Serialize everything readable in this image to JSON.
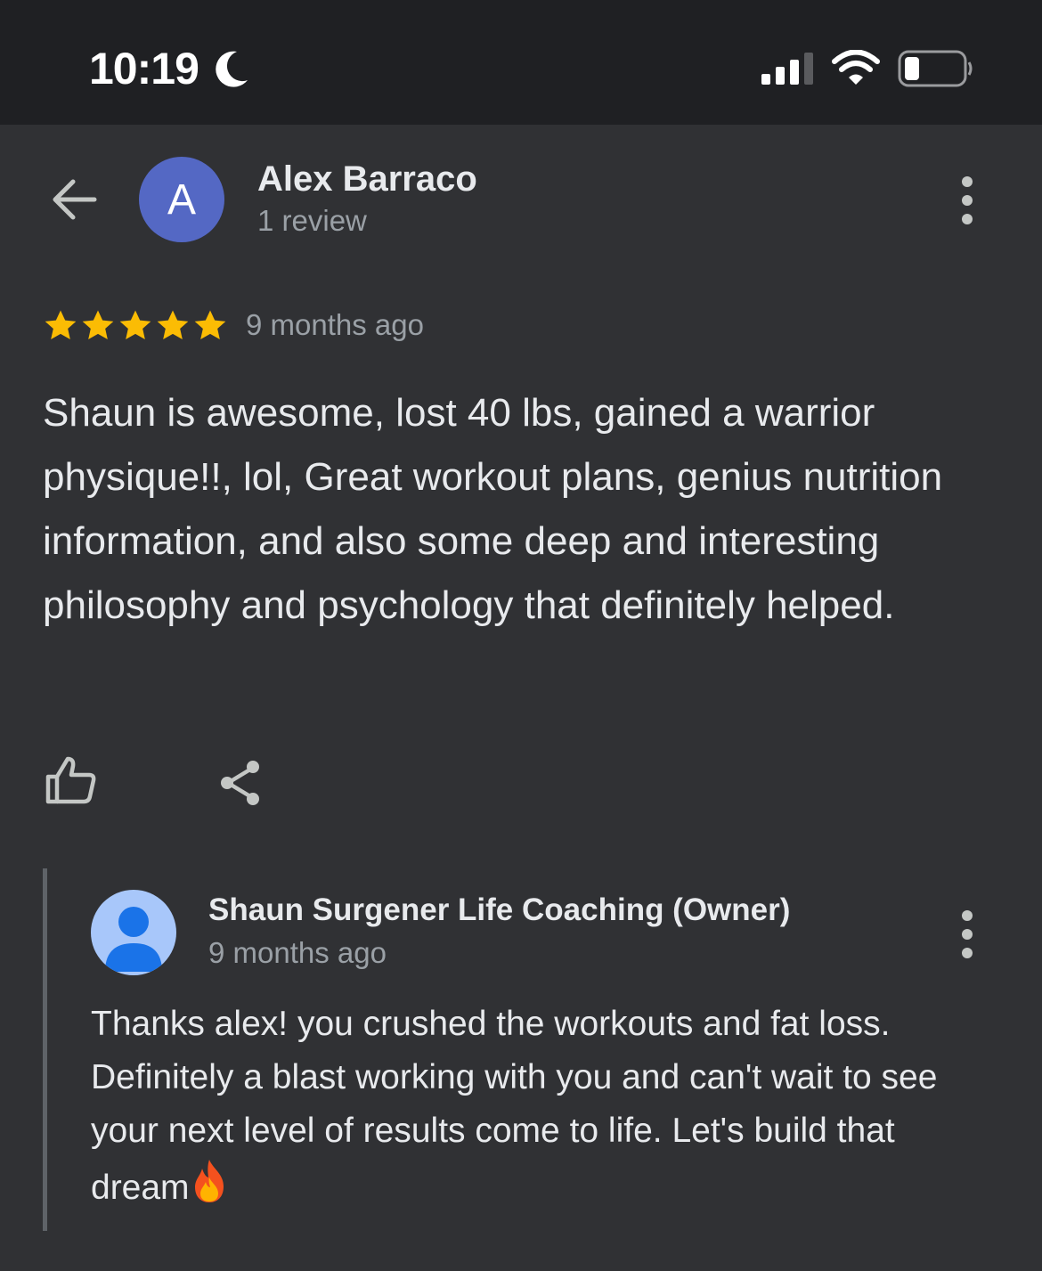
{
  "status_bar": {
    "time": "10:19",
    "icons": [
      "moon-icon",
      "signal-icon",
      "wifi-icon",
      "battery-icon"
    ]
  },
  "header": {
    "avatar_letter": "A",
    "avatar_color": "#5468c4",
    "name": "Alex Barraco",
    "review_count": "1 review"
  },
  "review": {
    "rating": 5,
    "max_rating": 5,
    "star_color": "#fbbc04",
    "time": "9 months ago",
    "text": "Shaun is awesome, lost 40 lbs, gained a warrior physique!!, lol, Great workout plans, genius nutrition information, and also some deep and interesting philosophy and psychology that definitely helped."
  },
  "actions": {
    "icons": [
      "thumbs-up-icon",
      "share-icon"
    ]
  },
  "owner_reply": {
    "name": "Shaun Surgener Life Coaching (Owner)",
    "time": "9 months ago",
    "text": "Thanks alex! you crushed the workouts and fat loss. Definitely a blast working with you and can't wait to see your next level of results come to life. Let's build that dream",
    "emoji": "fire-icon"
  },
  "colors": {
    "background": "#303134",
    "status_bar": "#1f2023",
    "primary_text": "#e8eaed",
    "secondary_text": "#9aa0a6",
    "owner_avatar": "#a8c7fa"
  }
}
